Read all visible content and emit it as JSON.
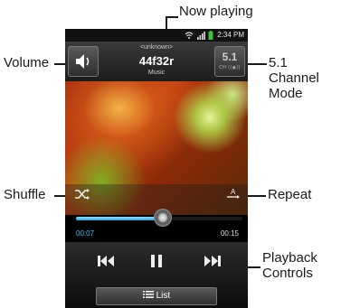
{
  "callouts": {
    "now_playing": "Now playing",
    "volume": "Volume",
    "channel_mode": "5.1 Channel Mode",
    "shuffle": "Shuffle",
    "repeat": "Repeat",
    "playback_controls": "Playback Controls"
  },
  "status_bar": {
    "time": "2:34 PM",
    "icons": [
      "wifi-icon",
      "signal-icon",
      "battery-icon"
    ]
  },
  "player": {
    "artist": "<unknown>",
    "title": "44f32r",
    "album": "Music",
    "channel_mode_label": "5.1",
    "channel_mode_sub": "CH ((◉))",
    "elapsed": "00:07",
    "total": "00:15",
    "progress": 0.52,
    "list_label": "List"
  },
  "colors": {
    "accent": "#3ac6ff",
    "background": "#000000"
  }
}
